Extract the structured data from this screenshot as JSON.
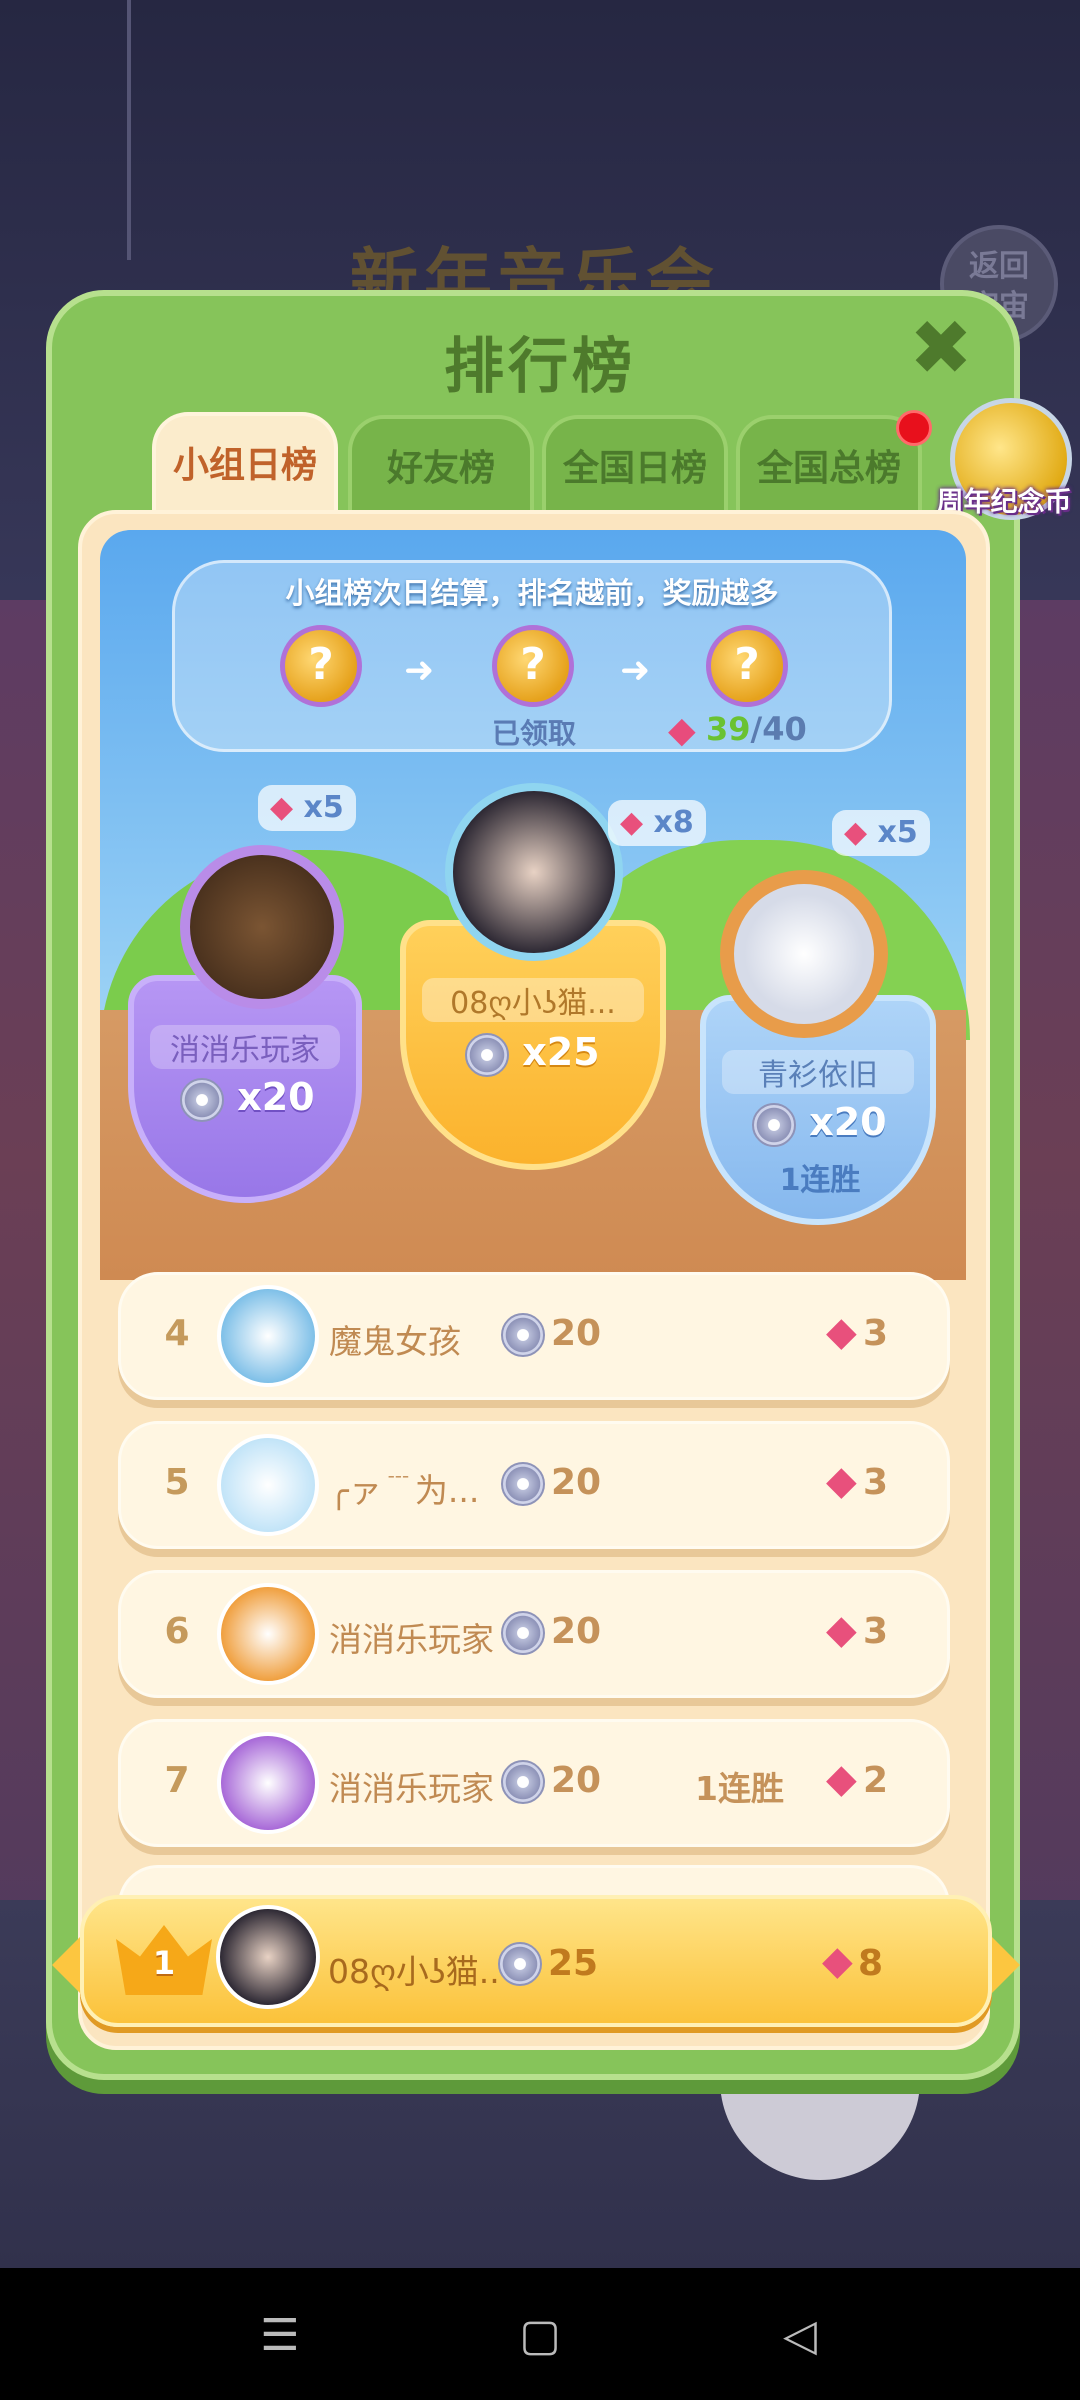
{
  "background": {
    "event_title": "新年音乐会",
    "back_button": "返回\n宇宙"
  },
  "modal": {
    "title": "排行榜",
    "close_icon": "close-icon"
  },
  "tabs": [
    {
      "label": "小组日榜",
      "active": true
    },
    {
      "label": "好友榜",
      "active": false
    },
    {
      "label": "全国日榜",
      "active": false
    },
    {
      "label": "全国总榜",
      "active": false
    }
  ],
  "anniversary": {
    "label": "周年纪念币"
  },
  "progress": {
    "hint": "小组榜次日结算，排名越前，奖励越多",
    "coin_glyph": "?",
    "claimed": "已领取",
    "current": "39",
    "total": "/40"
  },
  "podium": [
    {
      "rank": 2,
      "name": "消消乐玩家",
      "score": "x20",
      "puzzle": "x5",
      "streak": ""
    },
    {
      "rank": 1,
      "name": "08ღ小ʖ猫...",
      "score": "x25",
      "puzzle": "x8",
      "streak": ""
    },
    {
      "rank": 3,
      "name": "青衫依旧",
      "score": "x20",
      "puzzle": "x5",
      "streak": "1连胜"
    }
  ],
  "rows": [
    {
      "rank": "4",
      "name": "魔鬼女孩",
      "score": "20",
      "streak": "",
      "puzzle": "3",
      "avatar_color": "#7fc0e8"
    },
    {
      "rank": "5",
      "name": "╭ァ﹉为...",
      "score": "20",
      "streak": "",
      "puzzle": "3",
      "avatar_color": "#c2e4f8"
    },
    {
      "rank": "6",
      "name": "消消乐玩家",
      "score": "20",
      "streak": "",
      "puzzle": "3",
      "avatar_color": "#f0a040"
    },
    {
      "rank": "7",
      "name": "消消乐玩家",
      "score": "20",
      "streak": "1连胜",
      "puzzle": "2",
      "avatar_color": "#a86ad8"
    }
  ],
  "self": {
    "rank": "1",
    "name": "08ღ小ʖ猫...",
    "score": "25",
    "puzzle": "8"
  }
}
